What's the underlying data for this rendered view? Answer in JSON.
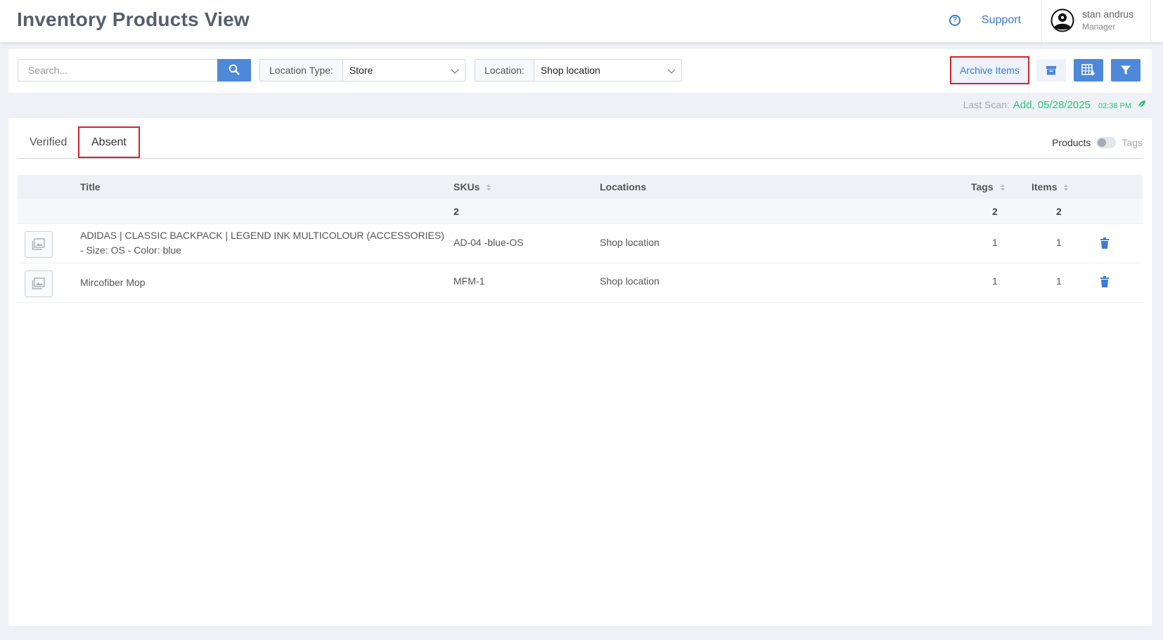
{
  "header": {
    "title": "Inventory Products View",
    "support_label": "Support",
    "user": {
      "name": "stan andrus",
      "role": "Manager"
    }
  },
  "toolbar": {
    "search_placeholder": "Search...",
    "location_type": {
      "label": "Location Type:",
      "value": "Store"
    },
    "location": {
      "label": "Location:",
      "value": "Shop location"
    },
    "archive_items_label": "Archive Items"
  },
  "last_scan": {
    "label": "Last Scan:",
    "value": "Add, 05/28/2025",
    "time": "02:38 PM"
  },
  "tabs": [
    {
      "label": "Verified",
      "active": false
    },
    {
      "label": "Absent",
      "active": true
    }
  ],
  "view_toggle": {
    "left_label": "Products",
    "right_label": "Tags"
  },
  "table": {
    "columns": {
      "title": "Title",
      "skus": "SKUs",
      "locations": "Locations",
      "tags": "Tags",
      "items": "Items"
    },
    "totals": {
      "skus": "2",
      "tags": "2",
      "items": "2"
    },
    "rows": [
      {
        "title_line1": "ADIDAS | CLASSIC BACKPACK | LEGEND INK MULTICOLOUR (ACCESSORIES)",
        "title_line2": "- Size: OS - Color: blue",
        "sku": "AD-04 -blue-OS",
        "location": "Shop location",
        "tags": "1",
        "items": "1"
      },
      {
        "title_line1": "Mircofiber Mop",
        "title_line2": "",
        "sku": "MFM-1",
        "location": "Shop location",
        "tags": "1",
        "items": "1"
      }
    ]
  },
  "colors": {
    "accent": "#4e88d8",
    "link": "#3a7bd5",
    "highlight_border": "#d8232a",
    "scan_green": "#2ec27e"
  },
  "icons": [
    "help-circle-icon",
    "user-avatar-icon",
    "search-icon",
    "archive-box-icon",
    "excel-export-icon",
    "filter-icon",
    "leaf-icon",
    "image-placeholder-icon",
    "trash-icon",
    "sort-icon"
  ]
}
